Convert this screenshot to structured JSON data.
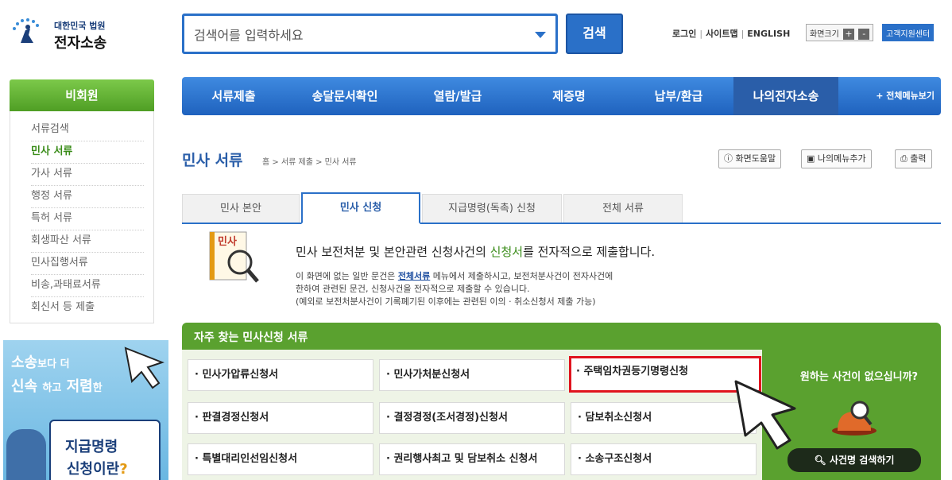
{
  "header": {
    "logo_org": "대한민국 법원",
    "logo_name": "전자소송",
    "search_placeholder": "검색어를 입력하세요",
    "search_button": "검색",
    "links": [
      "로그인",
      "사이트맵",
      "ENGLISH"
    ],
    "font_size_label": "화면크기",
    "font_plus": "+",
    "font_minus": "-",
    "support_label": "고객지원센터"
  },
  "sidebar": {
    "heading": "비회원",
    "items": [
      {
        "label": "서류검색",
        "active": false
      },
      {
        "label": "민사 서류",
        "active": true
      },
      {
        "label": "가사 서류",
        "active": false
      },
      {
        "label": "행정 서류",
        "active": false
      },
      {
        "label": "특허 서류",
        "active": false
      },
      {
        "label": "회생파산 서류",
        "active": false
      },
      {
        "label": "민사집행서류",
        "active": false
      },
      {
        "label": "비송,과태료서류",
        "active": false
      },
      {
        "label": "회신서 등 제출",
        "active": false
      }
    ],
    "banner": {
      "line1_a": "소송",
      "line1_b": "보다 더",
      "line2_a": "신속",
      "line2_b": "하고",
      "line2_c": "저렴",
      "line2_d": "한",
      "line3": "지급명령",
      "line4": "신청이란",
      "line4_mark": "?"
    }
  },
  "nav": {
    "tabs": [
      "서류제출",
      "송달문서확인",
      "열람/발급",
      "제증명",
      "납부/환급",
      "나의전자소송"
    ],
    "all_menu": "+ 전체메뉴보기"
  },
  "page": {
    "title": "민사 서류",
    "breadcrumb": "홈 > 서류 제출 > 민사 서류",
    "tools": [
      "화면도움말",
      "나의메뉴추가",
      "출력"
    ]
  },
  "subtabs": [
    {
      "label": "민사 본안",
      "active": false
    },
    {
      "label": "민사 신청",
      "active": true
    },
    {
      "label": "지급명령(독촉) 신청",
      "active": false
    },
    {
      "label": "전체 서류",
      "active": false
    }
  ],
  "intro": {
    "icon_label": "민사",
    "headline_a": "민사 보전처분 및 본안관련 신청사건의 ",
    "headline_b": "신청서",
    "headline_c": "를 전자적으로 제출합니다.",
    "body_a": "이 화면에 없는 일반 문건은 ",
    "body_link": "전체서류",
    "body_b": " 메뉴에서 제출하시고, 보전처분사건이 전자사건에",
    "body_line2": "한하여 관련된 문건, 신청사건을 전자적으로 제출할 수 있습니다.",
    "body_line3": "(예외로 보전처분사건이 기록폐기된 이후에는 관련된 이의 · 취소신청서 제출 가능)"
  },
  "frequent": {
    "title": "자주 찾는 민사신청 서류",
    "cells": [
      [
        "· 민사가압류신청서",
        "· 민사가처분신청서",
        "· 주택임차권등기명령신청"
      ],
      [
        "· 판결경정신청서",
        "· 결정경정(조서경정)신청서",
        "· 담보취소신청서"
      ],
      [
        "· 특별대리인선임신청서",
        "· 권리행사최고 및 담보취소 신청서",
        "· 소송구조신청서"
      ]
    ],
    "highlighted": "· 주택임차권등기명령신청",
    "side_question": "원하는 사건이 없으십니까?",
    "side_button": "사건명 검색하기"
  }
}
